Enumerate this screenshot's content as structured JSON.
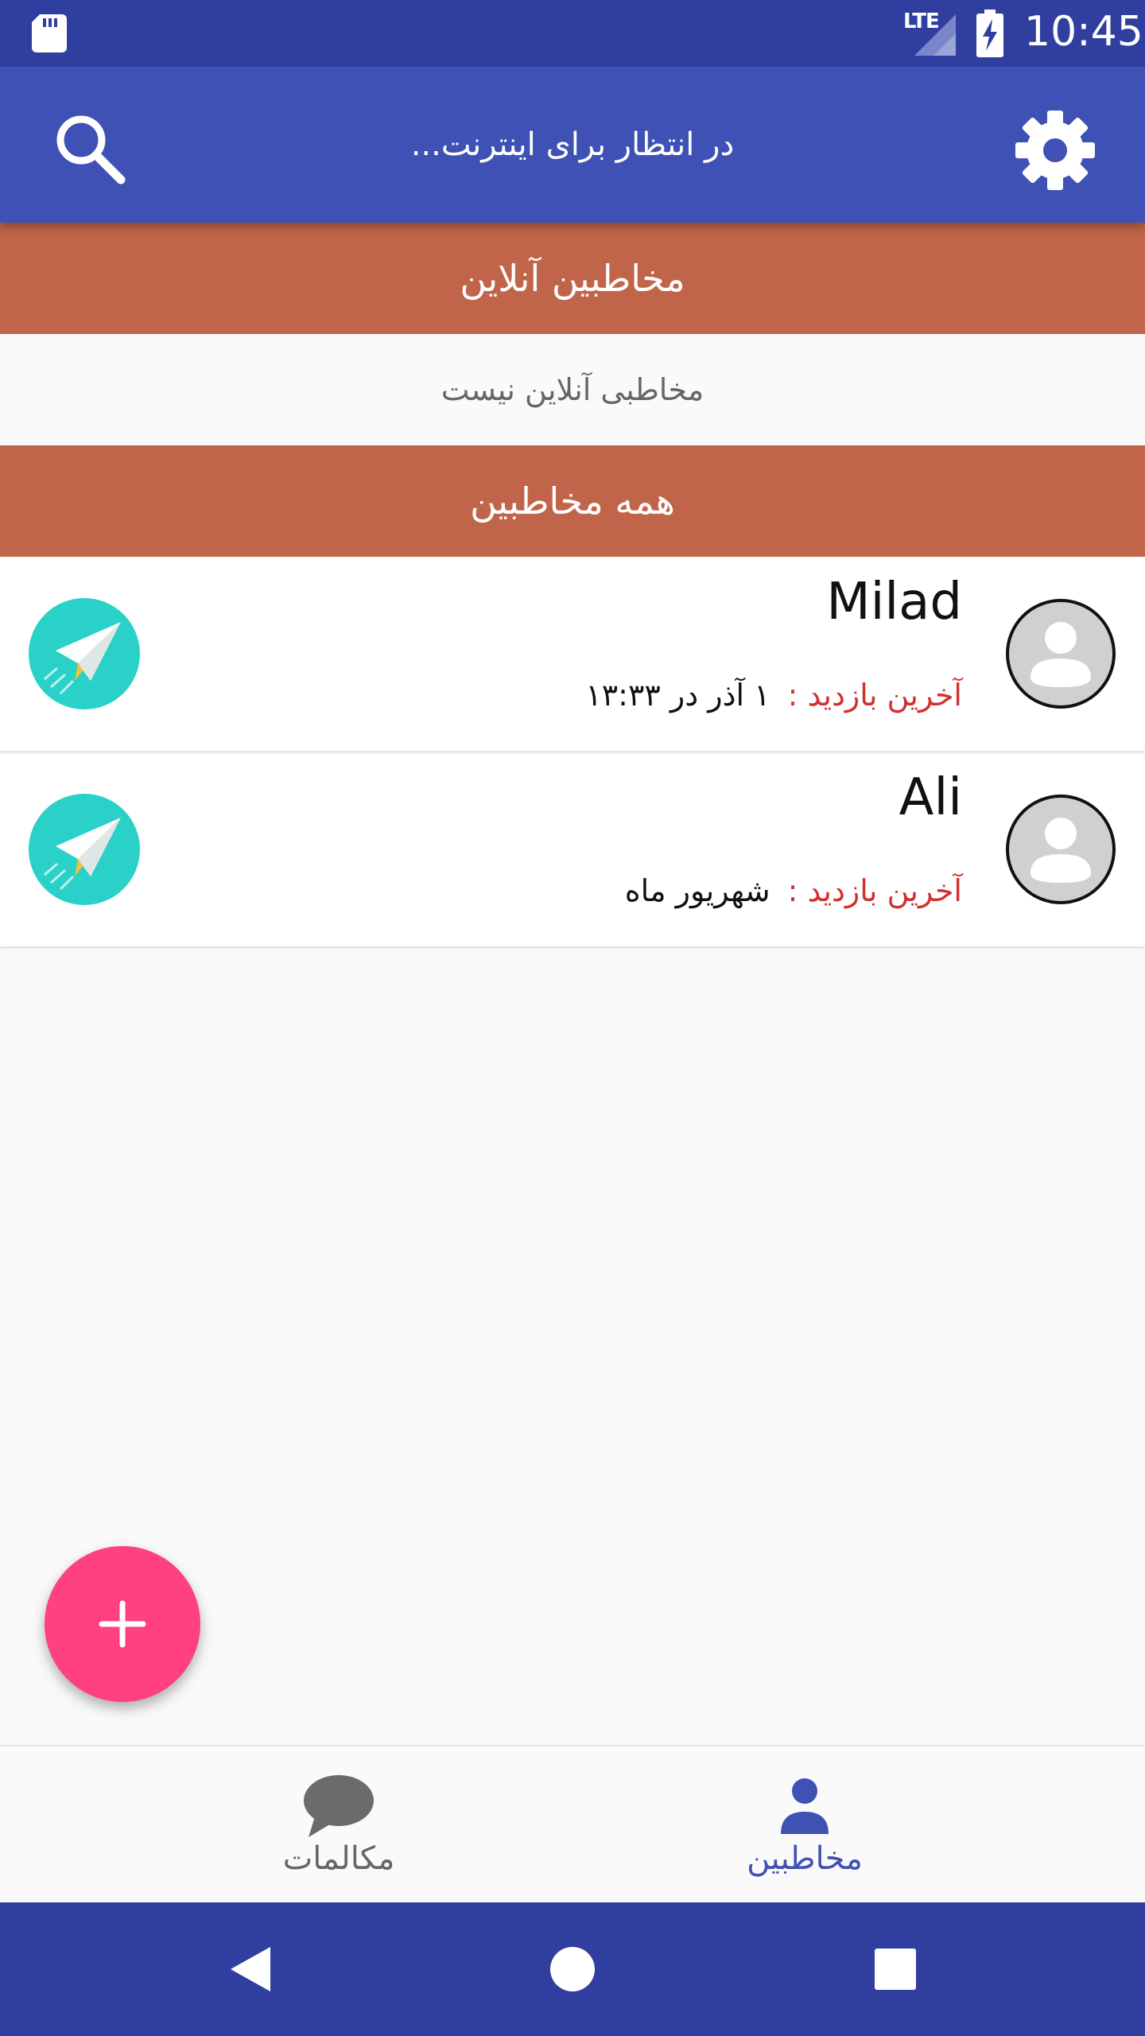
{
  "status_bar": {
    "network": "LTE",
    "time": "10:45"
  },
  "app_bar": {
    "title": "در انتظار برای اینترنت..."
  },
  "sections": {
    "online": {
      "title": "مخاطبین آنلاین",
      "empty_message": "مخاطبی آنلاین نیست"
    },
    "all": {
      "title": "همه مخاطبین"
    }
  },
  "contacts": [
    {
      "name": "Milad",
      "last_seen_label": "آخرین بازدید :",
      "last_seen_value": "۱ آذر در ۱۳:۳۳"
    },
    {
      "name": "Ali",
      "last_seen_label": "آخرین بازدید :",
      "last_seen_value": "شهریور ماه"
    }
  ],
  "bottom_nav": {
    "tabs": [
      {
        "label": "مکالمات",
        "icon": "chat-bubble-icon",
        "active": false
      },
      {
        "label": "مخاطبین",
        "icon": "person-icon",
        "active": true
      }
    ]
  },
  "colors": {
    "status_bar": "#303f9f",
    "app_bar": "#3f51b5",
    "section_header": "#c1654a",
    "fab": "#ff4081",
    "send_button": "#2ad1c9",
    "last_seen_label": "#d32f2f",
    "active_tab": "#3f51b5"
  }
}
